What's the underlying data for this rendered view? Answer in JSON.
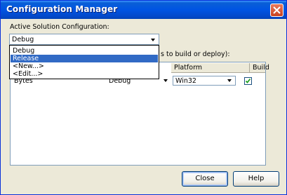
{
  "window": {
    "title": "Configuration Manager"
  },
  "active_config": {
    "label": "Active Solution Configuration:",
    "value": "Debug"
  },
  "dropdown": {
    "options": [
      "Debug",
      "Release",
      "<New...>",
      "<Edit...>"
    ],
    "selected": "Release"
  },
  "contexts_label": "s to build or deploy):",
  "grid": {
    "headers": [
      "Platform",
      "Build"
    ],
    "row": {
      "project": "Bytes",
      "configuration": "Debug",
      "platform": "Win32",
      "build_checked": true
    }
  },
  "buttons": {
    "close": "Close",
    "help": "Help"
  }
}
